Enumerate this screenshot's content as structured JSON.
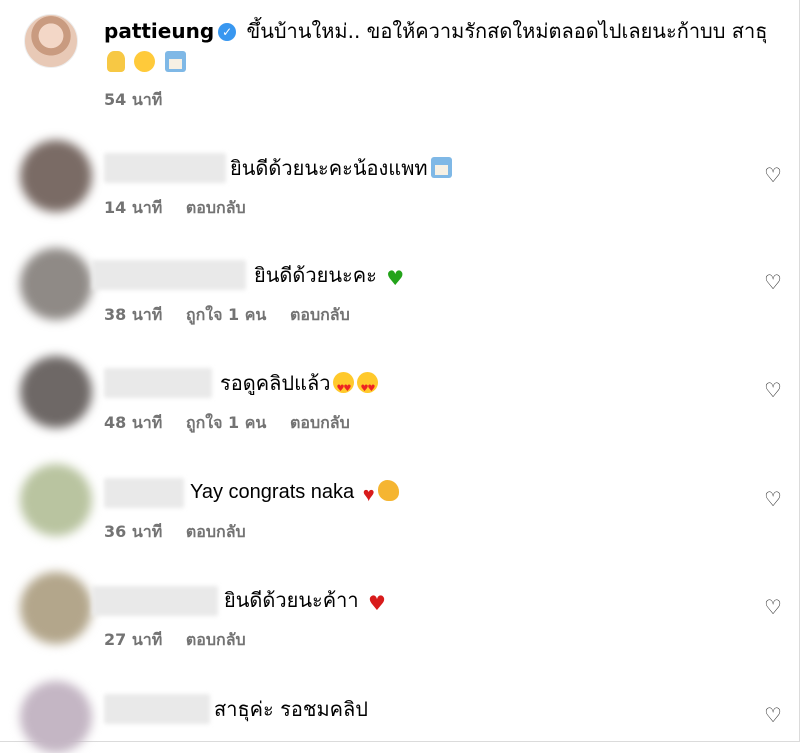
{
  "post": {
    "username": "pattieung",
    "caption": "ขึ้นบ้านใหม่.. ขอให้ความรักสดใหม่ตลอดไปเลยนะก้าบบ สาธุ",
    "time": "54 นาที"
  },
  "comments": [
    {
      "text": "ยินดีด้วยนะคะน้องแพท",
      "time": "14 นาที",
      "likes": "",
      "reply": "ตอบกลับ",
      "emoji": [
        "house-emoji"
      ]
    },
    {
      "text": "ยินดีด้วยนะคะ",
      "time": "38 นาที",
      "likes": "ถูกใจ 1 คน",
      "reply": "ตอบกลับ",
      "emoji": [
        "green-heart-emoji"
      ]
    },
    {
      "text": "รอดูคลิปแล้ว",
      "time": "48 นาที",
      "likes": "ถูกใจ 1 คน",
      "reply": "ตอบกลับ",
      "emoji": [
        "heart-eyes-emoji",
        "heart-eyes-emoji"
      ]
    },
    {
      "text": "Yay congrats naka",
      "time": "36 นาที",
      "likes": "",
      "reply": "ตอบกลับ",
      "emoji": [
        "red-heart-emoji",
        "clap-emoji"
      ]
    },
    {
      "text": "ยินดีด้วยนะค้าา",
      "time": "27 นาที",
      "likes": "",
      "reply": "ตอบกลับ",
      "emoji": [
        "red-heart-emoji"
      ]
    },
    {
      "text": "สาธุค่ะ รอชมคลิป",
      "time": "",
      "likes": "",
      "reply": "",
      "emoji": []
    }
  ],
  "icons": {
    "like": "heart-outline-icon",
    "verified": "verified-badge-icon"
  },
  "colors": {
    "verified": "#3897f0",
    "meta": "#737373",
    "green_heart": "#23a31a",
    "red_heart": "#d81b1b"
  }
}
